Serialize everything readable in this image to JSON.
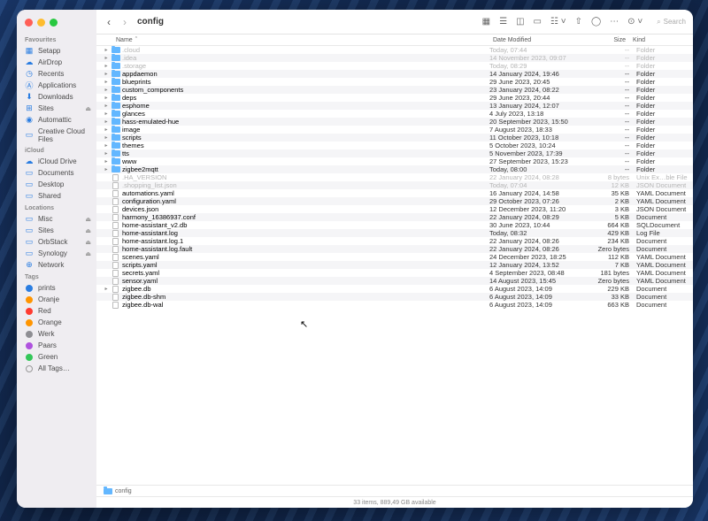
{
  "window_title": "config",
  "search_placeholder": "Search",
  "sidebar": {
    "sections": [
      {
        "header": "Favourites",
        "items": [
          {
            "icon": "▦",
            "label": "Setapp"
          },
          {
            "icon": "☁",
            "label": "AirDrop"
          },
          {
            "icon": "◷",
            "label": "Recents"
          },
          {
            "icon": "Ⓐ",
            "label": "Applications"
          },
          {
            "icon": "⬇",
            "label": "Downloads"
          },
          {
            "icon": "⊞",
            "label": "Sites",
            "eject": true
          },
          {
            "icon": "◉",
            "label": "Automattic"
          },
          {
            "icon": "▭",
            "label": "Creative Cloud Files"
          }
        ]
      },
      {
        "header": "iCloud",
        "items": [
          {
            "icon": "☁",
            "label": "iCloud Drive"
          },
          {
            "icon": "▭",
            "label": "Documents"
          },
          {
            "icon": "▭",
            "label": "Desktop"
          },
          {
            "icon": "▭",
            "label": "Shared"
          }
        ]
      },
      {
        "header": "Locations",
        "items": [
          {
            "icon": "▭",
            "label": "Misc",
            "eject": true
          },
          {
            "icon": "▭",
            "label": "Sites",
            "eject": true
          },
          {
            "icon": "▭",
            "label": "OrbStack",
            "eject": true
          },
          {
            "icon": "▭",
            "label": "Synology",
            "eject": true
          },
          {
            "icon": "⊕",
            "label": "Network"
          }
        ]
      },
      {
        "header": "Tags",
        "items": [
          {
            "tag": "#2a7de1",
            "label": "prints"
          },
          {
            "tag": "#ff9500",
            "label": "Oranje"
          },
          {
            "tag": "#ff3b30",
            "label": "Red"
          },
          {
            "tag": "#ff9500",
            "label": "Orange"
          },
          {
            "tag": "#8e8e93",
            "label": "Werk"
          },
          {
            "tag": "#af52de",
            "label": "Paars"
          },
          {
            "tag": "#34c759",
            "label": "Green"
          },
          {
            "tag": "",
            "label": "All Tags…"
          }
        ]
      }
    ]
  },
  "columns": {
    "name": "Name",
    "date": "Date Modified",
    "size": "Size",
    "kind": "Kind"
  },
  "files": [
    {
      "disc": "▸",
      "type": "folder",
      "name": ".cloud",
      "date": "Today, 07:44",
      "size": "--",
      "kind": "Folder",
      "dim": true
    },
    {
      "disc": "▸",
      "type": "folder",
      "name": ".idea",
      "date": "14 November 2023, 09:07",
      "size": "--",
      "kind": "Folder",
      "dim": true
    },
    {
      "disc": "▸",
      "type": "folder",
      "name": ".storage",
      "date": "Today, 08:29",
      "size": "--",
      "kind": "Folder",
      "dim": true
    },
    {
      "disc": "▸",
      "type": "folder",
      "name": "appdaemon",
      "date": "14 January 2024, 19:46",
      "size": "--",
      "kind": "Folder"
    },
    {
      "disc": "▸",
      "type": "folder",
      "name": "blueprints",
      "date": "29 June 2023, 20:45",
      "size": "--",
      "kind": "Folder"
    },
    {
      "disc": "▸",
      "type": "folder",
      "name": "custom_components",
      "date": "23 January 2024, 08:22",
      "size": "--",
      "kind": "Folder"
    },
    {
      "disc": "▸",
      "type": "folder",
      "name": "deps",
      "date": "29 June 2023, 20:44",
      "size": "--",
      "kind": "Folder"
    },
    {
      "disc": "▸",
      "type": "folder",
      "name": "esphome",
      "date": "13 January 2024, 12:07",
      "size": "--",
      "kind": "Folder"
    },
    {
      "disc": "▸",
      "type": "folder",
      "name": "glances",
      "date": "4 July 2023, 13:18",
      "size": "--",
      "kind": "Folder"
    },
    {
      "disc": "▸",
      "type": "folder",
      "name": "hass-emulated-hue",
      "date": "20 September 2023, 15:50",
      "size": "--",
      "kind": "Folder"
    },
    {
      "disc": "▸",
      "type": "folder",
      "name": "image",
      "date": "7 August 2023, 18:33",
      "size": "--",
      "kind": "Folder"
    },
    {
      "disc": "▸",
      "type": "folder",
      "name": "scripts",
      "date": "11 October 2023, 10:18",
      "size": "--",
      "kind": "Folder"
    },
    {
      "disc": "▸",
      "type": "folder",
      "name": "themes",
      "date": "5 October 2023, 10:24",
      "size": "--",
      "kind": "Folder"
    },
    {
      "disc": "▸",
      "type": "folder",
      "name": "tts",
      "date": "5 November 2023, 17:39",
      "size": "--",
      "kind": "Folder"
    },
    {
      "disc": "▸",
      "type": "folder",
      "name": "www",
      "date": "27 September 2023, 15:23",
      "size": "--",
      "kind": "Folder"
    },
    {
      "disc": "▸",
      "type": "folder",
      "name": "zigbee2mqtt",
      "date": "Today, 08:00",
      "size": "--",
      "kind": "Folder"
    },
    {
      "disc": "",
      "type": "file",
      "name": ".HA_VERSION",
      "date": "22 January 2024, 08:28",
      "size": "8 bytes",
      "kind": "Unix Ex…ble File",
      "dim": true
    },
    {
      "disc": "",
      "type": "file",
      "name": ".shopping_list.json",
      "date": "Today, 07:04",
      "size": "12 KB",
      "kind": "JSON Document",
      "dim": true
    },
    {
      "disc": "",
      "type": "file",
      "name": "automations.yaml",
      "date": "16 January 2024, 14:58",
      "size": "35 KB",
      "kind": "YAML Document"
    },
    {
      "disc": "",
      "type": "file",
      "name": "configuration.yaml",
      "date": "29 October 2023, 07:26",
      "size": "2 KB",
      "kind": "YAML Document"
    },
    {
      "disc": "",
      "type": "file",
      "name": "devices.json",
      "date": "12 December 2023, 11:20",
      "size": "3 KB",
      "kind": "JSON Document"
    },
    {
      "disc": "",
      "type": "file",
      "name": "harmony_16386937.conf",
      "date": "22 January 2024, 08:29",
      "size": "5 KB",
      "kind": "Document"
    },
    {
      "disc": "",
      "type": "file",
      "name": "home-assistant_v2.db",
      "date": "30 June 2023, 10:44",
      "size": "664 KB",
      "kind": "SQLDocument"
    },
    {
      "disc": "",
      "type": "file",
      "name": "home-assistant.log",
      "date": "Today, 08:32",
      "size": "429 KB",
      "kind": "Log File"
    },
    {
      "disc": "",
      "type": "file",
      "name": "home-assistant.log.1",
      "date": "22 January 2024, 08:26",
      "size": "234 KB",
      "kind": "Document"
    },
    {
      "disc": "",
      "type": "file",
      "name": "home-assistant.log.fault",
      "date": "22 January 2024, 08:26",
      "size": "Zero bytes",
      "kind": "Document"
    },
    {
      "disc": "",
      "type": "file",
      "name": "scenes.yaml",
      "date": "24 December 2023, 18:25",
      "size": "112 KB",
      "kind": "YAML Document"
    },
    {
      "disc": "",
      "type": "file",
      "name": "scripts.yaml",
      "date": "12 January 2024, 13:52",
      "size": "7 KB",
      "kind": "YAML Document"
    },
    {
      "disc": "",
      "type": "file",
      "name": "secrets.yaml",
      "date": "4 September 2023, 08:48",
      "size": "181 bytes",
      "kind": "YAML Document"
    },
    {
      "disc": "",
      "type": "file",
      "name": "sensor.yaml",
      "date": "14 August 2023, 15:45",
      "size": "Zero bytes",
      "kind": "YAML Document"
    },
    {
      "disc": "▸",
      "type": "file",
      "name": "zigbee.db",
      "date": "6 August 2023, 14:09",
      "size": "229 KB",
      "kind": "Document"
    },
    {
      "disc": "",
      "type": "file",
      "name": "zigbee.db-shm",
      "date": "6 August 2023, 14:09",
      "size": "33 KB",
      "kind": "Document"
    },
    {
      "disc": "",
      "type": "file",
      "name": "zigbee.db-wal",
      "date": "6 August 2023, 14:09",
      "size": "663 KB",
      "kind": "Document"
    }
  ],
  "pathbar": "config",
  "statusbar": "33 items, 889,49 GB available"
}
